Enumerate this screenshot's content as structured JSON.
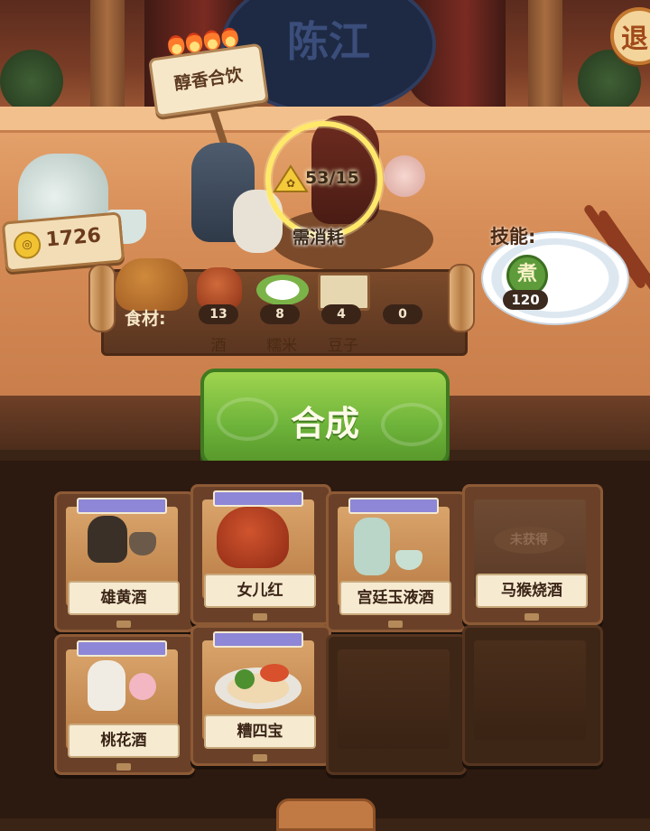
{
  "exit_button": {
    "label": "退"
  },
  "recipe": {
    "title": "醇香合饮",
    "flames": 4,
    "progress": {
      "current": 53,
      "required": 15,
      "text": "53/15"
    },
    "consume_label": "需消耗"
  },
  "coins": {
    "icon": "coin-icon",
    "value": "1726"
  },
  "skill": {
    "label": "技能:",
    "badge": "煮",
    "value": "120"
  },
  "ingredients": {
    "label": "食材:",
    "items": [
      {
        "icon": "wine-jar-icon",
        "count": "13",
        "name": "酒"
      },
      {
        "icon": "glutinous-rice-icon",
        "count": "8",
        "name": "糯米"
      },
      {
        "icon": "beans-box-icon",
        "count": "4",
        "name": "豆子"
      },
      {
        "icon": "empty-slot",
        "count": "0",
        "name": ""
      }
    ]
  },
  "synthesize_button": {
    "label": "合成"
  },
  "recipes_grid": [
    {
      "name": "雄黄酒",
      "obtained": true
    },
    {
      "name": "女儿红",
      "obtained": true
    },
    {
      "name": "宫廷玉液酒",
      "obtained": true
    },
    {
      "name": "马猴烧酒",
      "obtained": false,
      "stamp": "未获得"
    },
    {
      "name": "桃花酒",
      "obtained": true
    },
    {
      "name": "糟四宝",
      "obtained": true
    }
  ],
  "background_sign": {
    "text": "陈江"
  }
}
